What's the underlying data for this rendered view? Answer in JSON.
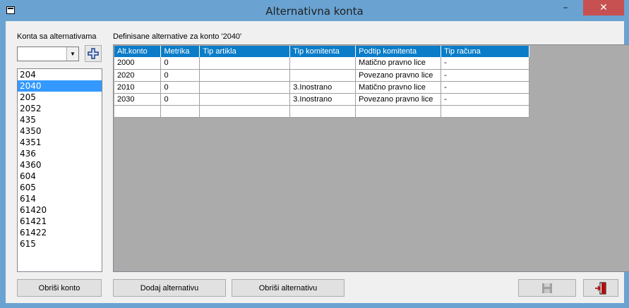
{
  "window": {
    "title": "Alternativna konta",
    "minimize": "–",
    "maximize": "□",
    "close": "✕"
  },
  "left": {
    "label": "Konta sa alternativama",
    "combo_value": "",
    "items": [
      "204",
      "2040",
      "205",
      "2052",
      "435",
      "4350",
      "4351",
      "436",
      "4360",
      "604",
      "605",
      "614",
      "61420",
      "61421",
      "61422",
      "615"
    ],
    "selected_index": 1
  },
  "right": {
    "label": "Definisane alternative za konto '2040'",
    "columns": [
      "Alt.konto",
      "Metrika",
      "Tip artikla",
      "Tip komitenta",
      "Podtip komitenta",
      "Tip računa"
    ],
    "rows": [
      [
        "2000",
        "0",
        "",
        "",
        "Matično pravno lice",
        "-"
      ],
      [
        "2020",
        "0",
        "",
        "",
        "Povezano pravno lice",
        "-"
      ],
      [
        "2010",
        "0",
        "",
        "3.Inostrano",
        "Matično pravno lice",
        "-"
      ],
      [
        "2030",
        "0",
        "",
        "3.Inostrano",
        "Povezano pravno lice",
        "-"
      ],
      [
        "",
        "",
        "",
        "",
        "",
        ""
      ]
    ]
  },
  "buttons": {
    "delete_account": "Obriši konto",
    "add_alternative": "Dodaj alternativu",
    "delete_alternative": "Obriši alternativu"
  },
  "colors": {
    "title_bar": "#6aa3d2",
    "header": "#0a7cc8",
    "selection": "#3399ff",
    "close": "#c75050"
  }
}
